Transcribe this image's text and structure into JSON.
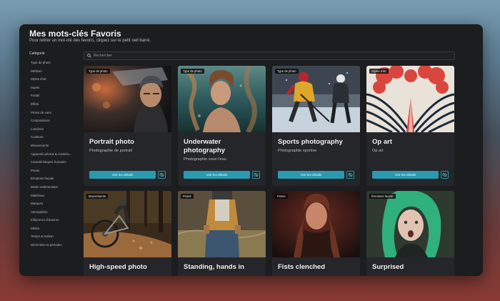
{
  "header": {
    "title": "Mes mots-clés Favoris",
    "subtitle": "Pour retirer un mot-clé des favoris, cliquez sur le petit oeil barré."
  },
  "sidebar": {
    "heading": "Catégorie",
    "items": [
      "Type de photo",
      "Médium",
      "Styles d'art",
      "Sujets",
      "Fonds",
      "Effets",
      "Prises de vues",
      "Compositions",
      "Lumières",
      "Couleurs",
      "Mouvements",
      "Appareils photos & Caméra...",
      "Caractéristiques humaine",
      "Poses",
      "Émotions faciale",
      "Mode vestimentaire",
      "Matériaux",
      "Marques",
      "Atmosphère",
      "Influences d'œuvres",
      "Météo",
      "Temps & Saison",
      "Décennies et périodes"
    ]
  },
  "search": {
    "placeholder": "Rechercher",
    "value": ""
  },
  "cards": [
    {
      "badge": "Type de photo",
      "title": "Portrait photo",
      "description": "Photographie de portrait",
      "button": "Voir les détails"
    },
    {
      "badge": "Type de photo",
      "title": "Underwater photography",
      "description": "Photographie sous l'eau",
      "button": "Voir les détails"
    },
    {
      "badge": "Type de photo",
      "title": "Sports photography",
      "description": "Photographie sportive",
      "button": "Voir les détails"
    },
    {
      "badge": "Styles d'art",
      "title": "Op art",
      "description": "Op art",
      "button": "Voir les détails"
    },
    {
      "badge": "Mouvements",
      "title": "High-speed photo",
      "description": "",
      "button": ""
    },
    {
      "badge": "Poses",
      "title": "Standing, hands in",
      "description": "",
      "button": ""
    },
    {
      "badge": "Poses",
      "title": "Fists clenched",
      "description": "",
      "button": ""
    },
    {
      "badge": "Émotions faciale",
      "title": "Surprised",
      "description": "",
      "button": ""
    }
  ],
  "icons": {
    "search": "search-icon",
    "hide": "eye-slash-icon"
  },
  "colors": {
    "accent": "#2a9ab0",
    "panel": "#1c1d1f",
    "card": "#25262a"
  }
}
